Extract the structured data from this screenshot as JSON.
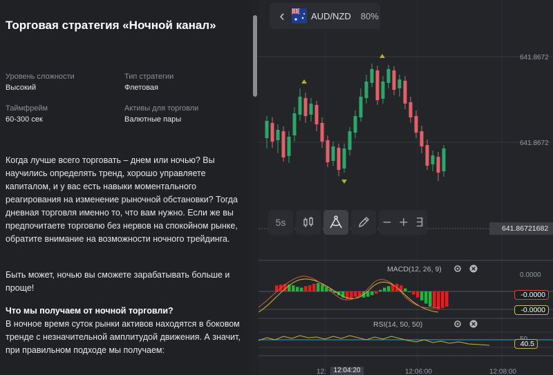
{
  "article": {
    "title": "Торговая стратегия «Ночной канал»",
    "meta": {
      "difficulty_label": "Уровень сложности",
      "difficulty_value": "Высокий",
      "type_label": "Тип стратегии",
      "type_value": "Флетовая",
      "timeframe_label": "Таймфрейм",
      "timeframe_value": "60-300 сек",
      "assets_label": "Активы для торговли",
      "assets_value": "Валютные пары"
    },
    "paragraph1": "Когда лучше всего торговать – днем или ночью? Вы научились определять тренд, хорошо управляете капиталом, и у вас есть навыки моментального реагирования на изменение рыночной обстановки? Тогда дневная торговля именно то, что вам нужно. Если же вы предпочитаете торговлю без нервов на спокойном рынке, обратите внимание на возможности ночного трейдинга.",
    "paragraph2": "Быть может, ночью вы сможете зарабатывать больше и проще!",
    "subheading": "Что мы получаем от ночной торговли?",
    "paragraph3": "В ночное время суток рынки активов находятся в боковом тренде с незначительной амплитудой движения. А значит, при правильном подходе мы получаем:"
  },
  "chart": {
    "asset": "AUD/NZD",
    "payout": "80%",
    "back_icon": "chevron-left-icon",
    "flag_icon": "australia-flag-icon",
    "timeframe_button": "5s",
    "price_levels": [
      "641.8672",
      "641.8672"
    ],
    "current_price": "641.86721682",
    "macd_label": "MACD(12, 26, 9)",
    "macd_value_top": "0.0000",
    "macd_value_signal": "-0.0000",
    "macd_value_hist": "-0.0000",
    "rsi_label": "RSI(14, 50, 50)",
    "rsi_level": "50",
    "rsi_value": "40.5",
    "time_labels": [
      "12:",
      "12:04:20",
      "12:06:00",
      "12:08:00"
    ],
    "colors": {
      "up": "#2ea66b",
      "down": "#e0616a",
      "macd_up": "#27b043",
      "macd_down": "#e02020",
      "signal": "#c9c13a",
      "rsi_line": "#c4b544",
      "rsi_base": "#2ea6c9",
      "arrow_up": "#b5ad3a"
    },
    "candles": [
      {
        "o": 200,
        "c": 175,
        "h": 168,
        "l": 215
      },
      {
        "o": 178,
        "c": 205,
        "h": 170,
        "l": 214
      },
      {
        "o": 203,
        "c": 188,
        "h": 180,
        "l": 222
      },
      {
        "o": 190,
        "c": 228,
        "h": 183,
        "l": 234
      },
      {
        "o": 226,
        "c": 198,
        "h": 190,
        "l": 236
      },
      {
        "o": 196,
        "c": 164,
        "h": 155,
        "l": 205
      },
      {
        "o": 166,
        "c": 140,
        "h": 128,
        "l": 175
      },
      {
        "o": 142,
        "c": 168,
        "h": 134,
        "l": 178
      },
      {
        "o": 166,
        "c": 150,
        "h": 142,
        "l": 176
      },
      {
        "o": 152,
        "c": 180,
        "h": 146,
        "l": 190
      },
      {
        "o": 178,
        "c": 205,
        "h": 170,
        "l": 214
      },
      {
        "o": 203,
        "c": 235,
        "h": 196,
        "l": 242
      },
      {
        "o": 233,
        "c": 212,
        "h": 205,
        "l": 240
      },
      {
        "o": 214,
        "c": 246,
        "h": 208,
        "l": 255
      },
      {
        "o": 244,
        "c": 215,
        "h": 208,
        "l": 250
      },
      {
        "o": 217,
        "c": 190,
        "h": 184,
        "l": 225
      },
      {
        "o": 192,
        "c": 168,
        "h": 160,
        "l": 200
      },
      {
        "o": 170,
        "c": 140,
        "h": 128,
        "l": 176
      },
      {
        "o": 142,
        "c": 118,
        "h": 108,
        "l": 150
      },
      {
        "o": 120,
        "c": 100,
        "h": 92,
        "l": 126
      },
      {
        "o": 102,
        "c": 145,
        "h": 95,
        "l": 152
      },
      {
        "o": 143,
        "c": 118,
        "h": 110,
        "l": 150
      },
      {
        "o": 120,
        "c": 100,
        "h": 94,
        "l": 128
      },
      {
        "o": 102,
        "c": 130,
        "h": 96,
        "l": 138
      },
      {
        "o": 128,
        "c": 115,
        "h": 108,
        "l": 140
      },
      {
        "o": 117,
        "c": 150,
        "h": 110,
        "l": 158
      },
      {
        "o": 148,
        "c": 170,
        "h": 140,
        "l": 178
      },
      {
        "o": 168,
        "c": 192,
        "h": 160,
        "l": 200
      },
      {
        "o": 190,
        "c": 212,
        "h": 182,
        "l": 222
      },
      {
        "o": 210,
        "c": 240,
        "h": 202,
        "l": 246
      },
      {
        "o": 238,
        "c": 225,
        "h": 218,
        "l": 248
      },
      {
        "o": 227,
        "c": 250,
        "h": 220,
        "l": 262
      },
      {
        "o": 248,
        "c": 215,
        "h": 210,
        "l": 256
      }
    ],
    "macd_hist": [
      8,
      9,
      10,
      9,
      8,
      6,
      5,
      7,
      8,
      10,
      11,
      9,
      6,
      3,
      -2,
      -5,
      -8,
      -10,
      -9,
      -7,
      -6,
      -8,
      -7,
      -5,
      -3,
      2,
      5,
      7,
      9,
      10,
      8,
      4,
      0,
      -4,
      -8,
      -12,
      -16,
      -20,
      -22,
      -24,
      -22,
      -20
    ]
  }
}
